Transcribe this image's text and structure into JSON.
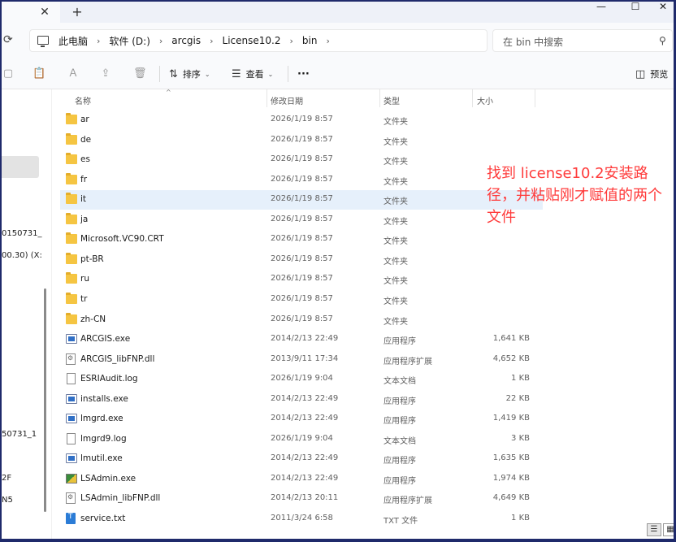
{
  "titlebar": {
    "tab_close": "✕",
    "new_tab": "+",
    "minimize": "—",
    "maximize": "☐",
    "close": "✕"
  },
  "address": {
    "crumbs": [
      "此电脑",
      "软件 (D:)",
      "arcgis",
      "License10.2",
      "bin"
    ],
    "separator": "›",
    "search_placeholder": "在 bin 中搜索"
  },
  "toolbar": {
    "sort_label": "排序",
    "view_label": "查看",
    "more_label": "···",
    "preview_label": "预览"
  },
  "left_pane": {
    "texts": [
      "0150731_",
      "00.30) (X:",
      "50731_1",
      "2F",
      "N5"
    ]
  },
  "columns": {
    "name": "名称",
    "date": "修改日期",
    "type": "类型",
    "size": "大小"
  },
  "files": [
    {
      "icon": "folder-icon",
      "name": "ar",
      "date": "2026/1/19 8:57",
      "type": "文件夹",
      "size": ""
    },
    {
      "icon": "folder-icon",
      "name": "de",
      "date": "2026/1/19 8:57",
      "type": "文件夹",
      "size": ""
    },
    {
      "icon": "folder-icon",
      "name": "es",
      "date": "2026/1/19 8:57",
      "type": "文件夹",
      "size": ""
    },
    {
      "icon": "folder-icon",
      "name": "fr",
      "date": "2026/1/19 8:57",
      "type": "文件夹",
      "size": ""
    },
    {
      "icon": "folder-icon",
      "name": "it",
      "date": "2026/1/19 8:57",
      "type": "文件夹",
      "size": "",
      "selected": true
    },
    {
      "icon": "folder-icon",
      "name": "ja",
      "date": "2026/1/19 8:57",
      "type": "文件夹",
      "size": ""
    },
    {
      "icon": "folder-icon",
      "name": "Microsoft.VC90.CRT",
      "date": "2026/1/19 8:57",
      "type": "文件夹",
      "size": ""
    },
    {
      "icon": "folder-icon",
      "name": "pt-BR",
      "date": "2026/1/19 8:57",
      "type": "文件夹",
      "size": ""
    },
    {
      "icon": "folder-icon",
      "name": "ru",
      "date": "2026/1/19 8:57",
      "type": "文件夹",
      "size": ""
    },
    {
      "icon": "folder-icon",
      "name": "tr",
      "date": "2026/1/19 8:57",
      "type": "文件夹",
      "size": ""
    },
    {
      "icon": "folder-icon",
      "name": "zh-CN",
      "date": "2026/1/19 8:57",
      "type": "文件夹",
      "size": ""
    },
    {
      "icon": "exe-icon",
      "name": "ARCGIS.exe",
      "date": "2014/2/13 22:49",
      "type": "应用程序",
      "size": "1,641 KB"
    },
    {
      "icon": "dll-icon",
      "name": "ARCGIS_libFNP.dll",
      "date": "2013/9/11 17:34",
      "type": "应用程序扩展",
      "size": "4,652 KB"
    },
    {
      "icon": "log-icon",
      "name": "ESRIAudit.log",
      "date": "2026/1/19 9:04",
      "type": "文本文档",
      "size": "1 KB"
    },
    {
      "icon": "exe-icon",
      "name": "installs.exe",
      "date": "2014/2/13 22:49",
      "type": "应用程序",
      "size": "22 KB"
    },
    {
      "icon": "exe-icon",
      "name": "lmgrd.exe",
      "date": "2014/2/13 22:49",
      "type": "应用程序",
      "size": "1,419 KB"
    },
    {
      "icon": "log-icon",
      "name": "lmgrd9.log",
      "date": "2026/1/19 9:04",
      "type": "文本文档",
      "size": "3 KB"
    },
    {
      "icon": "exe-icon",
      "name": "lmutil.exe",
      "date": "2014/2/13 22:49",
      "type": "应用程序",
      "size": "1,635 KB"
    },
    {
      "icon": "lsadmin-icon",
      "name": "LSAdmin.exe",
      "date": "2014/2/13 22:49",
      "type": "应用程序",
      "size": "1,974 KB"
    },
    {
      "icon": "dll-icon",
      "name": "LSAdmin_libFNP.dll",
      "date": "2014/2/13 20:11",
      "type": "应用程序扩展",
      "size": "4,649 KB"
    },
    {
      "icon": "txt-icon",
      "name": "service.txt",
      "date": "2011/3/24 6:58",
      "type": "TXT 文件",
      "size": "1 KB"
    }
  ],
  "annotation": {
    "text": "找到 license10.2安装路径，并粘贴刚才赋值的两个文件",
    "color": "#ff3b3b"
  },
  "colors": {
    "selected_row": "#e6f0fb",
    "folder": "#f5c542",
    "frame_border": "#1f2a6b"
  }
}
